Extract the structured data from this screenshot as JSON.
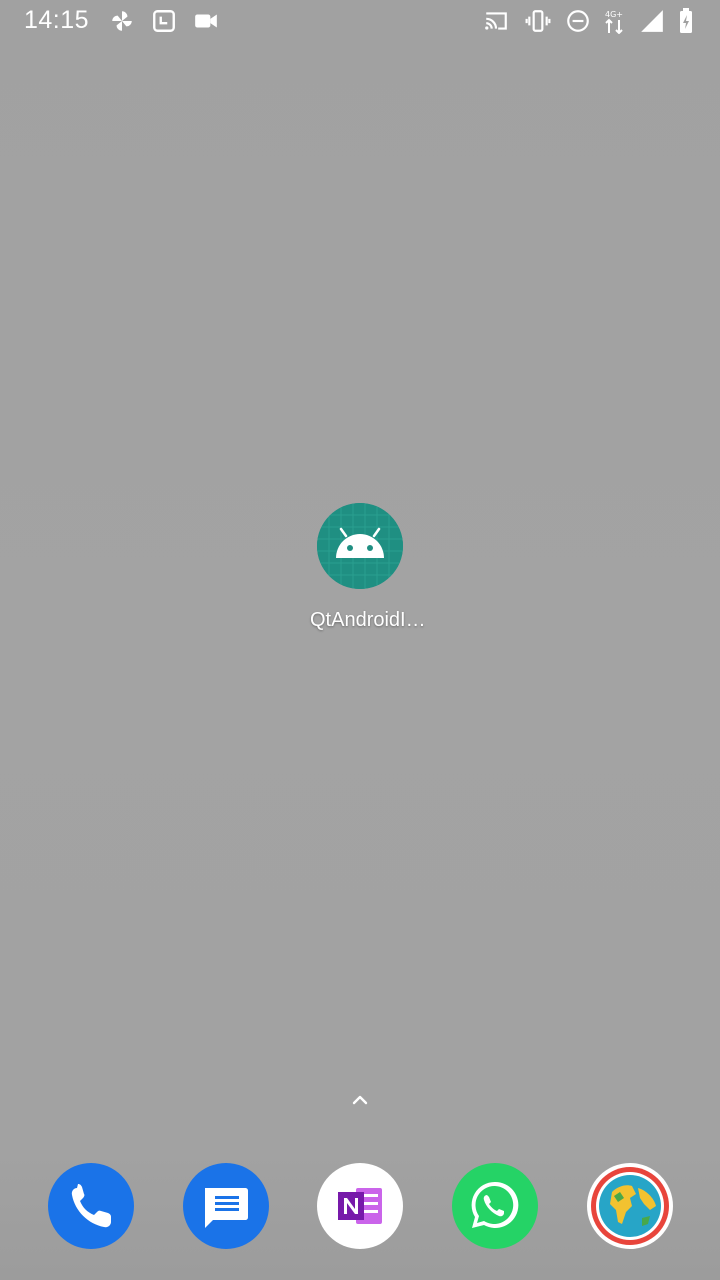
{
  "status_bar": {
    "time": "14:15",
    "network_label": "4G+",
    "left_icons": [
      "pinwheel-icon",
      "screenshot-icon",
      "video-camera-icon"
    ],
    "right_icons": [
      "cast-icon",
      "vibrate-icon",
      "do-not-disturb-icon",
      "mobile-data-icon",
      "signal-icon",
      "battery-icon"
    ]
  },
  "home": {
    "app": {
      "label": "QtAndroidI…",
      "icon": "android-robot-icon",
      "color": "#1f8f82"
    },
    "drawer_handle_icon": "chevron-up-icon"
  },
  "dock": {
    "apps": [
      {
        "name": "Phone",
        "icon": "phone-icon",
        "color": "#1a73e8"
      },
      {
        "name": "Messages",
        "icon": "messages-icon",
        "color": "#1a73e8"
      },
      {
        "name": "OneNote",
        "icon": "onenote-icon",
        "color": "#7719aa"
      },
      {
        "name": "WhatsApp",
        "icon": "whatsapp-icon",
        "color": "#25d366"
      },
      {
        "name": "Earth",
        "icon": "globe-icon",
        "color": "#e8453c"
      }
    ]
  }
}
